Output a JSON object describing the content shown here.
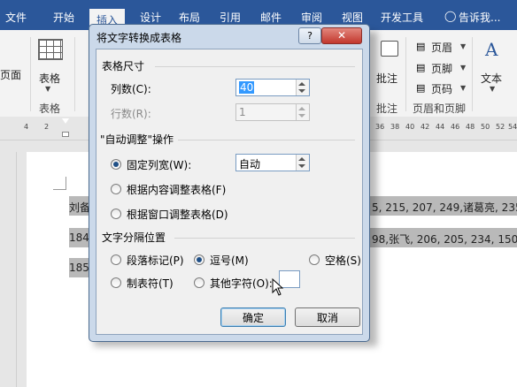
{
  "menubar": {
    "tabs": [
      "文件",
      "开始",
      "插入",
      "设计",
      "布局",
      "引用",
      "邮件",
      "审阅",
      "视图",
      "开发工具"
    ],
    "tell_me": "告诉我...",
    "active_tab": "插入"
  },
  "ribbon": {
    "pages_label": "页面",
    "table_button": "表格",
    "table_group": "表格",
    "comment_button": "批注",
    "comment_group": "批注",
    "header_btn": "页眉",
    "footer_btn": "页脚",
    "page_number_btn": "页码",
    "header_footer_group": "页眉和页脚",
    "text_button": "文本"
  },
  "ruler": {
    "left_numbers": [
      "4",
      "2"
    ],
    "right_numbers": [
      "36",
      "38",
      "40",
      "42",
      "44",
      "46",
      "48",
      "50",
      "52",
      "54"
    ]
  },
  "document": {
    "line1_left": "刘备",
    "line1_right": "5, 215, 207, 249,诸葛亮, 235",
    "line2_left": "184",
    "line2_right": "98,张飞, 206, 205, 234, 150,",
    "line3_left": "185"
  },
  "dialog": {
    "title": "将文字转换成表格",
    "help": "?",
    "close": "✕",
    "table_size": {
      "heading": "表格尺寸",
      "columns_label": "列数(C):",
      "columns_value": "40",
      "rows_label": "行数(R):",
      "rows_value": "1"
    },
    "autofit": {
      "heading": "\"自动调整\"操作",
      "fixed_label": "固定列宽(W):",
      "fixed_value": "自动",
      "content_label": "根据内容调整表格(F)",
      "window_label": "根据窗口调整表格(D)",
      "selected": "fixed"
    },
    "separator": {
      "heading": "文字分隔位置",
      "paragraph": "段落标记(P)",
      "comma": "逗号(M)",
      "space": "空格(S)",
      "tab": "制表符(T)",
      "other": "其他字符(O):",
      "other_value": "",
      "selected": "comma"
    },
    "ok": "确定",
    "cancel": "取消"
  },
  "colors": {
    "ribbon_blue": "#2b579a",
    "dialog_frame": "#cbd9ea",
    "selection": "#b9b9b9"
  }
}
